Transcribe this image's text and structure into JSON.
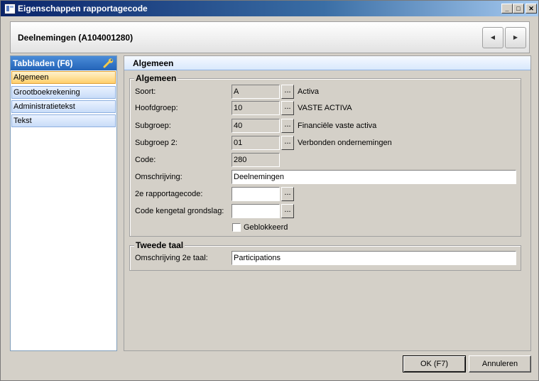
{
  "window": {
    "title": "Eigenschappen rapportagecode",
    "controls": {
      "minimize_icon": "minimize-icon",
      "maximize_icon": "maximize-icon",
      "close_icon": "close-icon"
    }
  },
  "header": {
    "record_title": "Deelnemingen (A104001280)",
    "prev_icon": "triangle-left-icon",
    "next_icon": "triangle-right-icon"
  },
  "sidebar": {
    "title": "Tabbladen (F6)",
    "icon": "wrench-icon",
    "items": [
      {
        "label": "Algemeen",
        "active": true
      },
      {
        "label": "Grootboekrekening",
        "active": false
      },
      {
        "label": "Administratietekst",
        "active": false
      },
      {
        "label": "Tekst",
        "active": false
      }
    ]
  },
  "section": {
    "title": "Algemeen"
  },
  "general": {
    "title": "Algemeen",
    "fields": {
      "soort": {
        "label": "Soort:",
        "value": "A",
        "button": "...",
        "description": "Activa"
      },
      "hoofdgroep": {
        "label": "Hoofdgroep:",
        "value": "10",
        "button": "...",
        "description": "VASTE ACTIVA"
      },
      "subgroep": {
        "label": "Subgroep:",
        "value": "40",
        "button": "...",
        "description": "Financiële vaste activa"
      },
      "subgroep2": {
        "label": "Subgroep 2:",
        "value": "01",
        "button": "...",
        "description": "Verbonden ondernemingen"
      },
      "code": {
        "label": "Code:",
        "value": "280"
      },
      "omschrijving": {
        "label": "Omschrijving:",
        "value": "Deelnemingen"
      },
      "rapportagecode2": {
        "label": "2e rapportagecode:",
        "value": "",
        "button": "..."
      },
      "kengetal": {
        "label": "Code kengetal grondslag:",
        "value": "",
        "button": "..."
      },
      "geblokkeerd": {
        "label": "Geblokkeerd",
        "checked": false
      }
    }
  },
  "second_language": {
    "title": "Tweede taal",
    "fields": {
      "omschrijving2": {
        "label": "Omschrijving 2e taal:",
        "value": "Participations"
      }
    }
  },
  "footer": {
    "ok_label": "OK (F7)",
    "cancel_label": "Annuleren"
  },
  "colors": {
    "titlebar": "#0a246a",
    "sidebar_header": "#2464b8",
    "active_tab": "#ffcf6b",
    "tab": "#c8dcf8"
  }
}
